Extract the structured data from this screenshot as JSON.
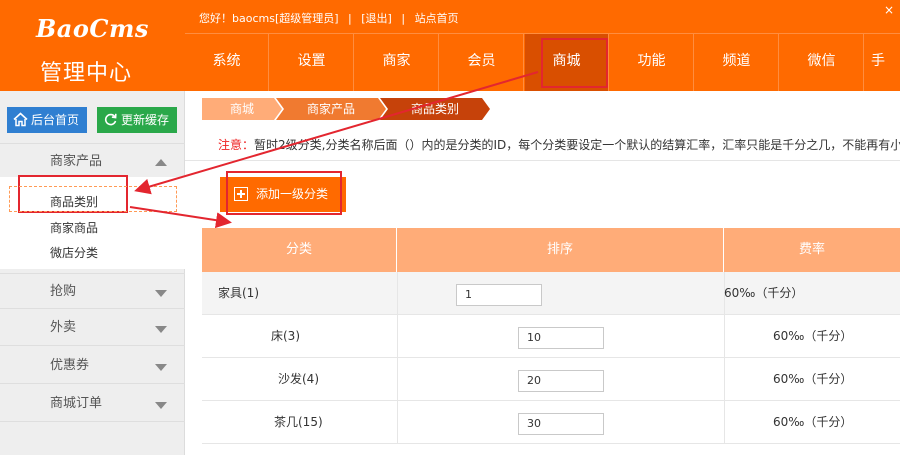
{
  "brand": {
    "logo": "BaoCms",
    "subtitle": "管理中心"
  },
  "topbar": {
    "greeting": "您好！baocms[超级管理员]",
    "logout": "[退出]",
    "site_home": "站点首页",
    "separator": "|",
    "close_glyph": "×"
  },
  "nav": {
    "items": [
      "系统",
      "设置",
      "商家",
      "会员",
      "商城",
      "功能",
      "频道",
      "微信",
      "手"
    ],
    "active": "商城"
  },
  "sidebar": {
    "home_button": "后台首页",
    "refresh_button": "更新缓存",
    "groups": [
      {
        "label": "商家产品",
        "expanded": true
      },
      {
        "label": "抢购",
        "expanded": false
      },
      {
        "label": "外卖",
        "expanded": false
      },
      {
        "label": "优惠券",
        "expanded": false
      },
      {
        "label": "商城订单",
        "expanded": false
      }
    ],
    "subitems": [
      "商品类别",
      "商家商品",
      "微店分类"
    ],
    "selected_subitem": "商品类别"
  },
  "breadcrumb": [
    "商城",
    "商家产品",
    "商品类别"
  ],
  "notice": {
    "label": "注意：",
    "text": "暂时2级分类,分类名称后面（）内的是分类的ID，每个分类要设定一个默认的结算汇率，汇率只能是千分之几，不能再有小数"
  },
  "toolbar": {
    "add_button": "添加一级分类"
  },
  "table": {
    "headers": [
      "分类",
      "排序",
      "费率"
    ],
    "rows": [
      {
        "name": "家具(1)",
        "order": "1",
        "rate": "60‰（千分）",
        "level": 1
      },
      {
        "name": "床(3)",
        "order": "10",
        "rate": "60‰（千分）",
        "level": 2
      },
      {
        "name": "沙发(4)",
        "order": "20",
        "rate": "60‰（千分）",
        "level": 2
      },
      {
        "name": "茶几(15)",
        "order": "30",
        "rate": "60‰（千分）",
        "level": 2
      }
    ]
  },
  "colors": {
    "brand_orange": "#ff6a00",
    "nav_active": "#d94f00",
    "table_header": "#ffac78",
    "annotation_red": "#e3262f",
    "home_button": "#2f7fd1",
    "refresh_button": "#2aa84a"
  },
  "icons": [
    "home-icon",
    "refresh-icon",
    "plus-icon",
    "caret-up-icon",
    "caret-down-icon",
    "close-icon"
  ]
}
